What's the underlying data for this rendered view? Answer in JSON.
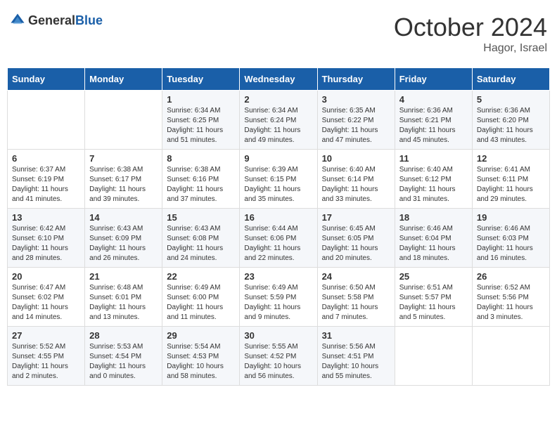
{
  "header": {
    "logo_general": "General",
    "logo_blue": "Blue",
    "month_title": "October 2024",
    "location": "Hagor, Israel"
  },
  "weekdays": [
    "Sunday",
    "Monday",
    "Tuesday",
    "Wednesday",
    "Thursday",
    "Friday",
    "Saturday"
  ],
  "weeks": [
    [
      {
        "day": "",
        "info": ""
      },
      {
        "day": "",
        "info": ""
      },
      {
        "day": "1",
        "info": "Sunrise: 6:34 AM\nSunset: 6:25 PM\nDaylight: 11 hours and 51 minutes."
      },
      {
        "day": "2",
        "info": "Sunrise: 6:34 AM\nSunset: 6:24 PM\nDaylight: 11 hours and 49 minutes."
      },
      {
        "day": "3",
        "info": "Sunrise: 6:35 AM\nSunset: 6:22 PM\nDaylight: 11 hours and 47 minutes."
      },
      {
        "day": "4",
        "info": "Sunrise: 6:36 AM\nSunset: 6:21 PM\nDaylight: 11 hours and 45 minutes."
      },
      {
        "day": "5",
        "info": "Sunrise: 6:36 AM\nSunset: 6:20 PM\nDaylight: 11 hours and 43 minutes."
      }
    ],
    [
      {
        "day": "6",
        "info": "Sunrise: 6:37 AM\nSunset: 6:19 PM\nDaylight: 11 hours and 41 minutes."
      },
      {
        "day": "7",
        "info": "Sunrise: 6:38 AM\nSunset: 6:17 PM\nDaylight: 11 hours and 39 minutes."
      },
      {
        "day": "8",
        "info": "Sunrise: 6:38 AM\nSunset: 6:16 PM\nDaylight: 11 hours and 37 minutes."
      },
      {
        "day": "9",
        "info": "Sunrise: 6:39 AM\nSunset: 6:15 PM\nDaylight: 11 hours and 35 minutes."
      },
      {
        "day": "10",
        "info": "Sunrise: 6:40 AM\nSunset: 6:14 PM\nDaylight: 11 hours and 33 minutes."
      },
      {
        "day": "11",
        "info": "Sunrise: 6:40 AM\nSunset: 6:12 PM\nDaylight: 11 hours and 31 minutes."
      },
      {
        "day": "12",
        "info": "Sunrise: 6:41 AM\nSunset: 6:11 PM\nDaylight: 11 hours and 29 minutes."
      }
    ],
    [
      {
        "day": "13",
        "info": "Sunrise: 6:42 AM\nSunset: 6:10 PM\nDaylight: 11 hours and 28 minutes."
      },
      {
        "day": "14",
        "info": "Sunrise: 6:43 AM\nSunset: 6:09 PM\nDaylight: 11 hours and 26 minutes."
      },
      {
        "day": "15",
        "info": "Sunrise: 6:43 AM\nSunset: 6:08 PM\nDaylight: 11 hours and 24 minutes."
      },
      {
        "day": "16",
        "info": "Sunrise: 6:44 AM\nSunset: 6:06 PM\nDaylight: 11 hours and 22 minutes."
      },
      {
        "day": "17",
        "info": "Sunrise: 6:45 AM\nSunset: 6:05 PM\nDaylight: 11 hours and 20 minutes."
      },
      {
        "day": "18",
        "info": "Sunrise: 6:46 AM\nSunset: 6:04 PM\nDaylight: 11 hours and 18 minutes."
      },
      {
        "day": "19",
        "info": "Sunrise: 6:46 AM\nSunset: 6:03 PM\nDaylight: 11 hours and 16 minutes."
      }
    ],
    [
      {
        "day": "20",
        "info": "Sunrise: 6:47 AM\nSunset: 6:02 PM\nDaylight: 11 hours and 14 minutes."
      },
      {
        "day": "21",
        "info": "Sunrise: 6:48 AM\nSunset: 6:01 PM\nDaylight: 11 hours and 13 minutes."
      },
      {
        "day": "22",
        "info": "Sunrise: 6:49 AM\nSunset: 6:00 PM\nDaylight: 11 hours and 11 minutes."
      },
      {
        "day": "23",
        "info": "Sunrise: 6:49 AM\nSunset: 5:59 PM\nDaylight: 11 hours and 9 minutes."
      },
      {
        "day": "24",
        "info": "Sunrise: 6:50 AM\nSunset: 5:58 PM\nDaylight: 11 hours and 7 minutes."
      },
      {
        "day": "25",
        "info": "Sunrise: 6:51 AM\nSunset: 5:57 PM\nDaylight: 11 hours and 5 minutes."
      },
      {
        "day": "26",
        "info": "Sunrise: 6:52 AM\nSunset: 5:56 PM\nDaylight: 11 hours and 3 minutes."
      }
    ],
    [
      {
        "day": "27",
        "info": "Sunrise: 5:52 AM\nSunset: 4:55 PM\nDaylight: 11 hours and 2 minutes."
      },
      {
        "day": "28",
        "info": "Sunrise: 5:53 AM\nSunset: 4:54 PM\nDaylight: 11 hours and 0 minutes."
      },
      {
        "day": "29",
        "info": "Sunrise: 5:54 AM\nSunset: 4:53 PM\nDaylight: 10 hours and 58 minutes."
      },
      {
        "day": "30",
        "info": "Sunrise: 5:55 AM\nSunset: 4:52 PM\nDaylight: 10 hours and 56 minutes."
      },
      {
        "day": "31",
        "info": "Sunrise: 5:56 AM\nSunset: 4:51 PM\nDaylight: 10 hours and 55 minutes."
      },
      {
        "day": "",
        "info": ""
      },
      {
        "day": "",
        "info": ""
      }
    ]
  ]
}
